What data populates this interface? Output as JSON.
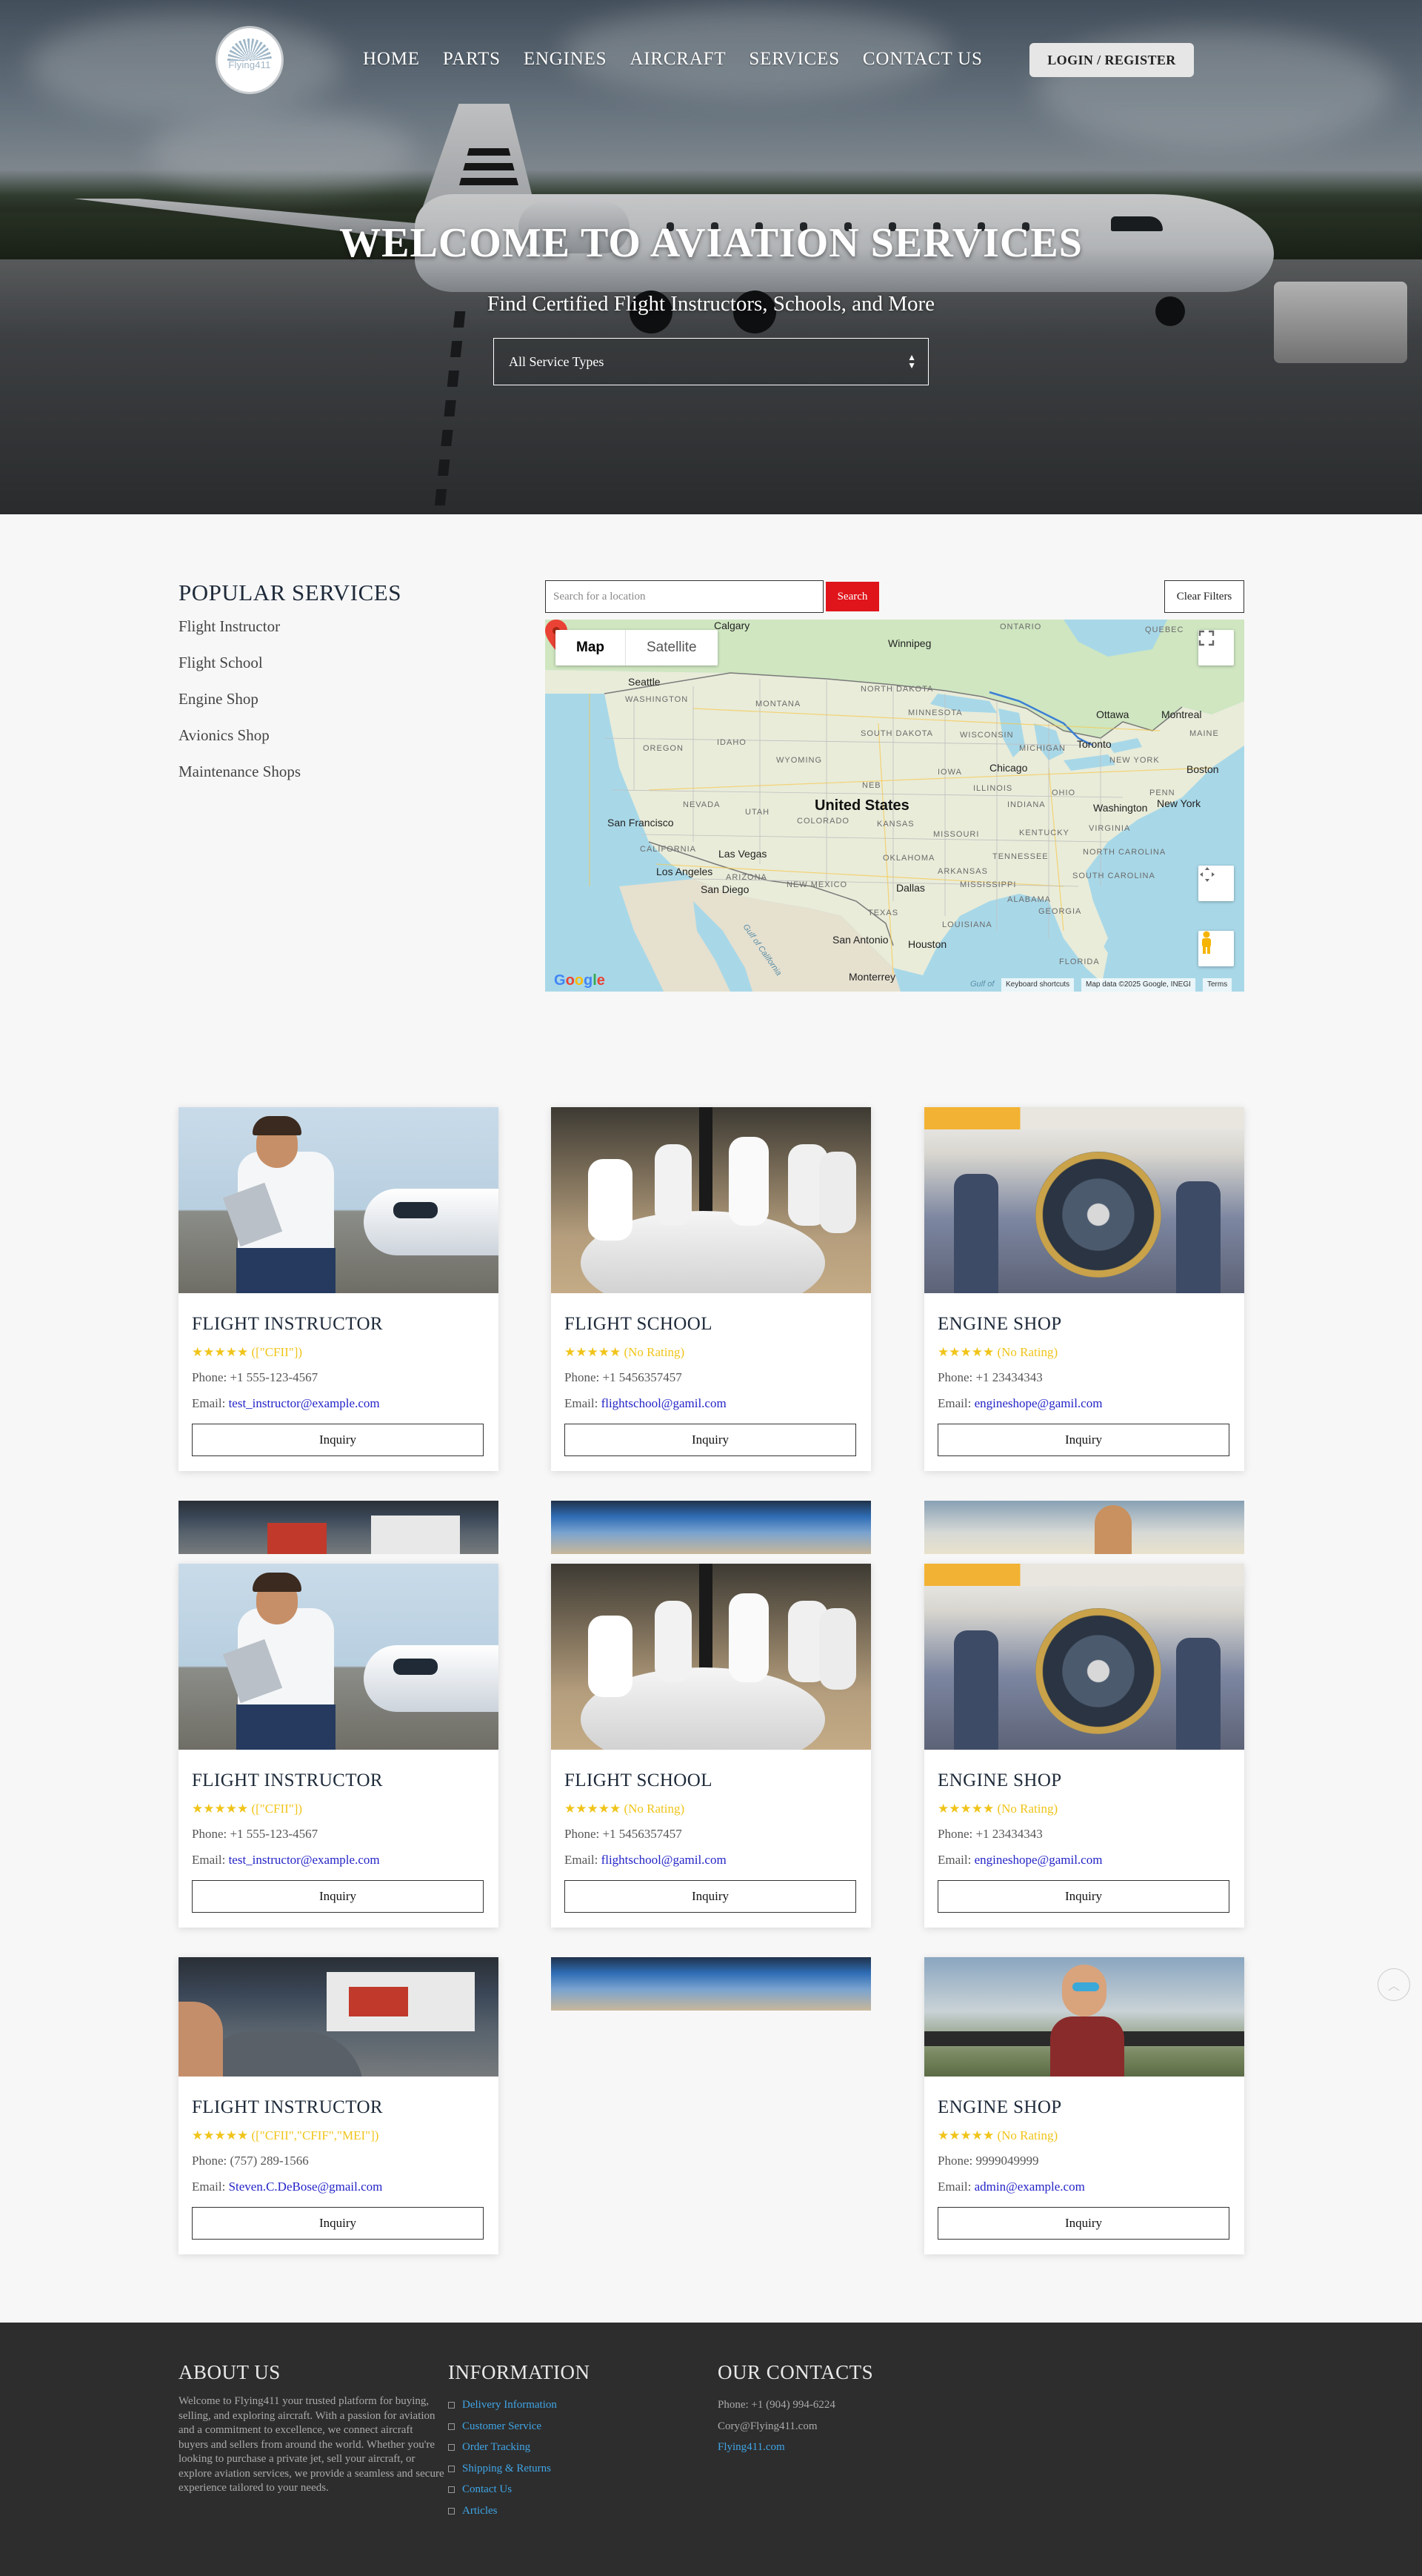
{
  "header": {
    "logo_text": "Flying411",
    "nav": [
      "HOME",
      "PARTS",
      "ENGINES",
      "AIRCRAFT",
      "SERVICES",
      "CONTACT US"
    ],
    "login_label": "LOGIN / REGISTER"
  },
  "hero": {
    "title": "WELCOME TO AVIATION SERVICES",
    "subtitle": "Find Certified Flight Instructors, Schools, and More",
    "select_value": "All Service Types"
  },
  "popular": {
    "heading": "POPULAR SERVICES",
    "items": [
      "Flight Instructor",
      "Flight School",
      "Engine Shop",
      "Avionics Shop",
      "Maintenance Shops"
    ]
  },
  "search": {
    "placeholder": "Search for a location",
    "button": "Search",
    "clear": "Clear Filters"
  },
  "map": {
    "type_map": "Map",
    "type_satellite": "Satellite",
    "country": "United States",
    "labels": {
      "calgary": "Calgary",
      "winnipeg": "Winnipeg",
      "ontario": "ONTARIO",
      "quebec": "QUEBEC",
      "seattle": "Seattle",
      "washington": "WASHINGTON",
      "montana": "MONTANA",
      "north_dakota": "NORTH\nDAKOTA",
      "minnesota": "MINNESOTA",
      "ottawa": "Ottawa",
      "montreal": "Montreal",
      "maine": "MAINE",
      "oregon": "OREGON",
      "idaho": "IDAHO",
      "south_dakota": "SOUTH\nDAKOTA",
      "wisconsin": "WISCONSIN",
      "michigan": "MICHIGAN",
      "toronto": "Toronto",
      "new_york_state": "NEW YORK",
      "boston": "Boston",
      "wyoming": "WYOMING",
      "iowa": "IOWA",
      "chicago": "Chicago",
      "nebraska": "NEB",
      "nevada": "NEVADA",
      "utah": "UTAH",
      "colorado": "COLORADO",
      "kansas": "KANSAS",
      "illinois": "ILLINOIS",
      "indiana": "INDIANA",
      "ohio": "OHIO",
      "penn": "PENN",
      "new_york": "New York",
      "washington_dc": "Washington",
      "san_francisco": "San Francisco",
      "california": "CALIFORNIA",
      "las_vegas": "Las Vegas",
      "missouri": "MISSOURI",
      "kentucky": "KENTUCKY",
      "virginia": "VIRGINIA",
      "oklahoma": "OKLAHOMA",
      "tennessee": "TENNESSEE",
      "north_carolina": "NORTH\nCAROLINA",
      "arizona": "ARIZONA",
      "los_angeles": "Los Angeles",
      "san_diego": "San Diego",
      "new_mexico": "NEW MEXICO",
      "arkansas": "ARKANSAS",
      "south_carolina": "SOUTH\nCAROLINA",
      "mississippi": "MISSISSIPPI",
      "dallas": "Dallas",
      "alabama": "ALABAMA",
      "georgia": "GEORGIA",
      "texas": "TEXAS",
      "louisiana": "LOUISIANA",
      "san_antonio": "San Antonio",
      "houston": "Houston",
      "florida": "FLORIDA",
      "monterrey": "Monterrey",
      "gulf": "Gulf of",
      "gulf_of_california": "Gulf of California"
    },
    "google": "Google",
    "shortcuts": "Keyboard shortcuts",
    "map_data": "Map data ©2025 Google, INEGI",
    "terms": "Terms"
  },
  "cards": [
    {
      "title": "FLIGHT INSTRUCTOR",
      "stars": "★★★★★",
      "rating": "([\"CFII\"])",
      "phone": "Phone: +1 555-123-4567",
      "email_label": "Email:",
      "email": "test_instructor@example.com",
      "button": "Inquiry",
      "image": "instructor"
    },
    {
      "title": "FLIGHT SCHOOL",
      "stars": "★★★★★",
      "rating": "(No Rating)",
      "phone": "Phone: +1 5456357457",
      "email_label": "Email:",
      "email": "flightschool@gamil.com",
      "button": "Inquiry",
      "image": "school"
    },
    {
      "title": "ENGINE SHOP",
      "stars": "★★★★★",
      "rating": "(No Rating)",
      "phone": "Phone: +1 23434343",
      "email_label": "Email:",
      "email": "engineshope@gamil.com",
      "button": "Inquiry",
      "image": "engine"
    },
    {
      "title": "FLIGHT INSTRUCTOR",
      "stars": "★★★★★",
      "rating": "([\"CFII\"])",
      "phone": "Phone: +1 555-123-4567",
      "email_label": "Email:",
      "email": "test_instructor@example.com",
      "button": "Inquiry",
      "image": "instructor"
    },
    {
      "title": "FLIGHT SCHOOL",
      "stars": "★★★★★",
      "rating": "(No Rating)",
      "phone": "Phone: +1 5456357457",
      "email_label": "Email:",
      "email": "flightschool@gamil.com",
      "button": "Inquiry",
      "image": "school"
    },
    {
      "title": "ENGINE SHOP",
      "stars": "★★★★★",
      "rating": "(No Rating)",
      "phone": "Phone: +1 23434343",
      "email_label": "Email:",
      "email": "engineshope@gamil.com",
      "button": "Inquiry",
      "image": "engine"
    },
    {
      "title": "FLIGHT INSTRUCTOR",
      "stars": "★★★★★",
      "rating": "([\"CFII\",\"CFIF\",\"MEI\"])",
      "phone": "Phone: (757) 289-1566",
      "email_label": "Email:",
      "email": "Steven.C.DeBose@gmail.com",
      "button": "Inquiry",
      "image": "selfie"
    },
    {
      "title": "ENGINE SHOP",
      "stars": "★★★★★",
      "rating": "(No Rating)",
      "phone": "Phone: 9999049999",
      "email_label": "Email:",
      "email": "admin@example.com",
      "button": "Inquiry",
      "image": "pilot"
    }
  ],
  "back_to_top_icon": "chevron-up-icon",
  "footer": {
    "about_heading": "ABOUT US",
    "about_text": "Welcome to Flying411 your trusted platform for buying, selling, and exploring aircraft. With a passion for aviation and a commitment to excellence, we connect aircraft buyers and sellers from around the world. Whether you're looking to purchase a private jet, sell your aircraft, or explore aviation services, we provide a seamless and secure experience tailored to your needs.",
    "info_heading": "INFORMATION",
    "info_links": [
      "Delivery Information",
      "Customer Service",
      "Order Tracking",
      "Shipping & Returns",
      "Contact Us",
      "Articles"
    ],
    "contacts_heading": "OUR CONTACTS",
    "phone": "Phone: +1 (904) 994-6224",
    "email": "Cory@Flying411.com",
    "site": "Flying411.com"
  },
  "colors": {
    "accent_red": "#e0141b",
    "link_blue": "#2323c8",
    "footer_link": "#3fa5e6",
    "star_gold": "#f0c419",
    "footer_bg": "#2d2d2d"
  }
}
